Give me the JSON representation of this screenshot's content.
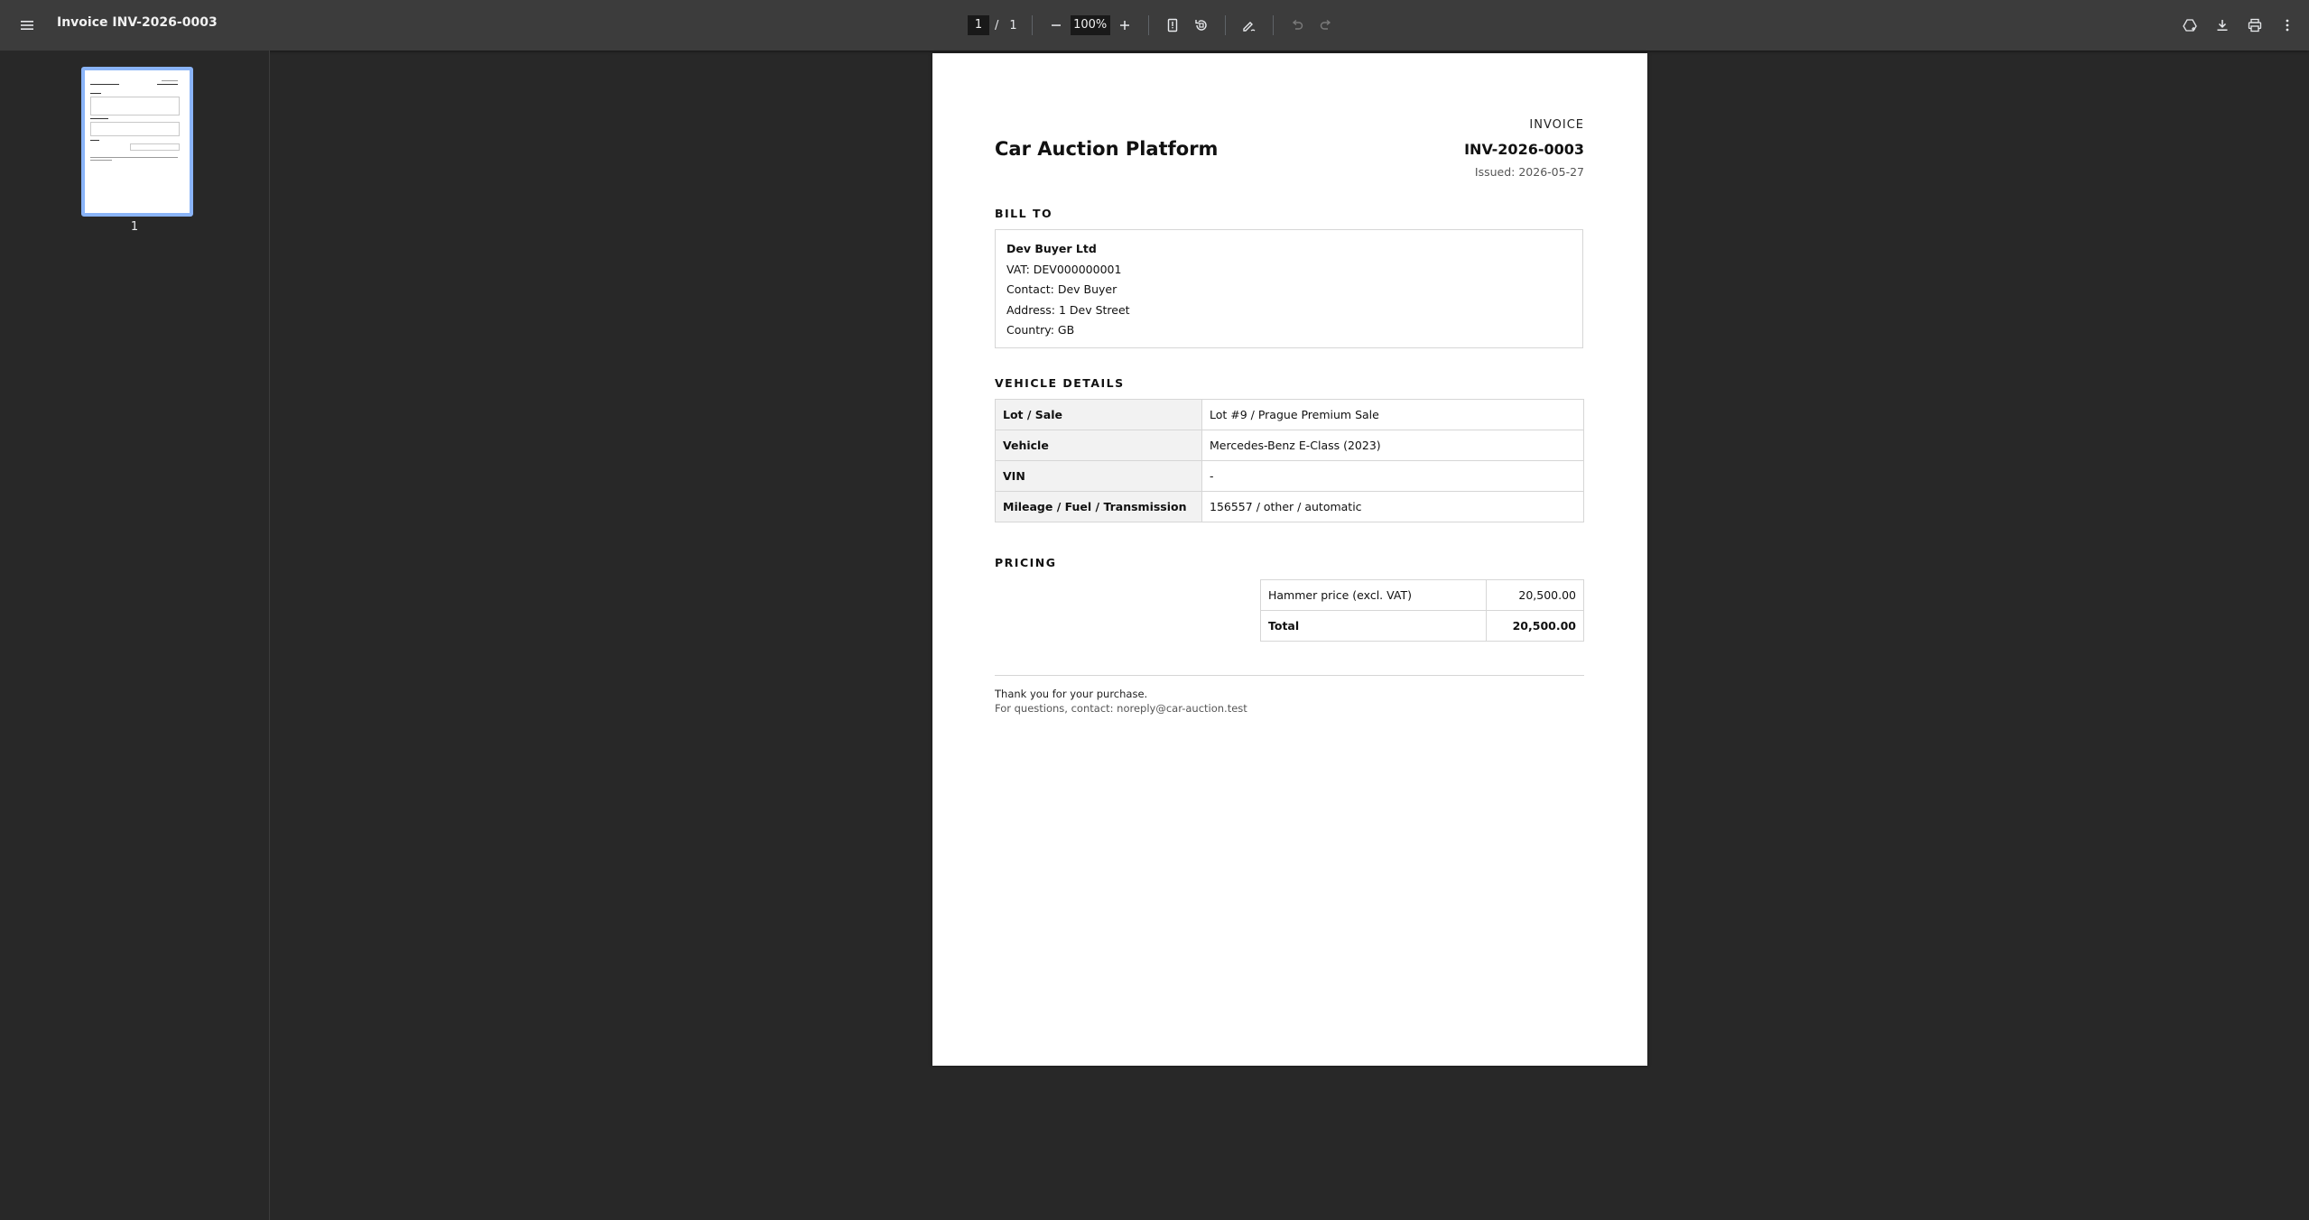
{
  "viewer": {
    "title": "Invoice INV-2026-0003",
    "current_page": "1",
    "page_separator": "/",
    "total_pages": "1",
    "zoom": "100%"
  },
  "sidebar": {
    "thumbnail_label": "1"
  },
  "invoice": {
    "company": "Car Auction Platform",
    "label": "INVOICE",
    "number": "INV-2026-0003",
    "issued": "Issued: 2026-05-27",
    "bill_to_heading": "BILL TO",
    "bill_to": {
      "name": "Dev Buyer Ltd",
      "vat": "VAT: DEV000000001",
      "contact": "Contact: Dev Buyer",
      "address": "Address: 1 Dev Street",
      "country": "Country: GB"
    },
    "vehicle_heading": "VEHICLE DETAILS",
    "vehicle_rows": [
      {
        "key": "Lot / Sale",
        "value": "Lot #9 / Prague Premium Sale"
      },
      {
        "key": "Vehicle",
        "value": "Mercedes-Benz E-Class (2023)"
      },
      {
        "key": "VIN",
        "value": "-"
      },
      {
        "key": "Mileage / Fuel / Transmission",
        "value": "156557 / other / automatic"
      }
    ],
    "pricing_heading": "PRICING",
    "pricing_rows": [
      {
        "label": "Hammer price (excl. VAT)",
        "amount": "20,500.00"
      },
      {
        "label": "Total",
        "amount": "20,500.00"
      }
    ],
    "footer_thanks": "Thank you for your purchase.",
    "footer_contact": "For questions, contact: noreply@car-auction.test"
  },
  "icons": {
    "menu": "menu-icon",
    "zoom_out": "minus-icon",
    "zoom_in": "plus-icon",
    "fit": "fit-page-icon",
    "rotate": "rotate-icon",
    "annotate": "pen-icon",
    "undo": "undo-icon",
    "redo": "redo-icon",
    "save_drive": "drive-save-icon",
    "download": "download-icon",
    "print": "print-icon",
    "more": "more-vert-icon"
  },
  "colors": {
    "toolbar": "#3c3c3c",
    "background": "#282828",
    "thumbnail_highlight": "#8ab4f8"
  }
}
